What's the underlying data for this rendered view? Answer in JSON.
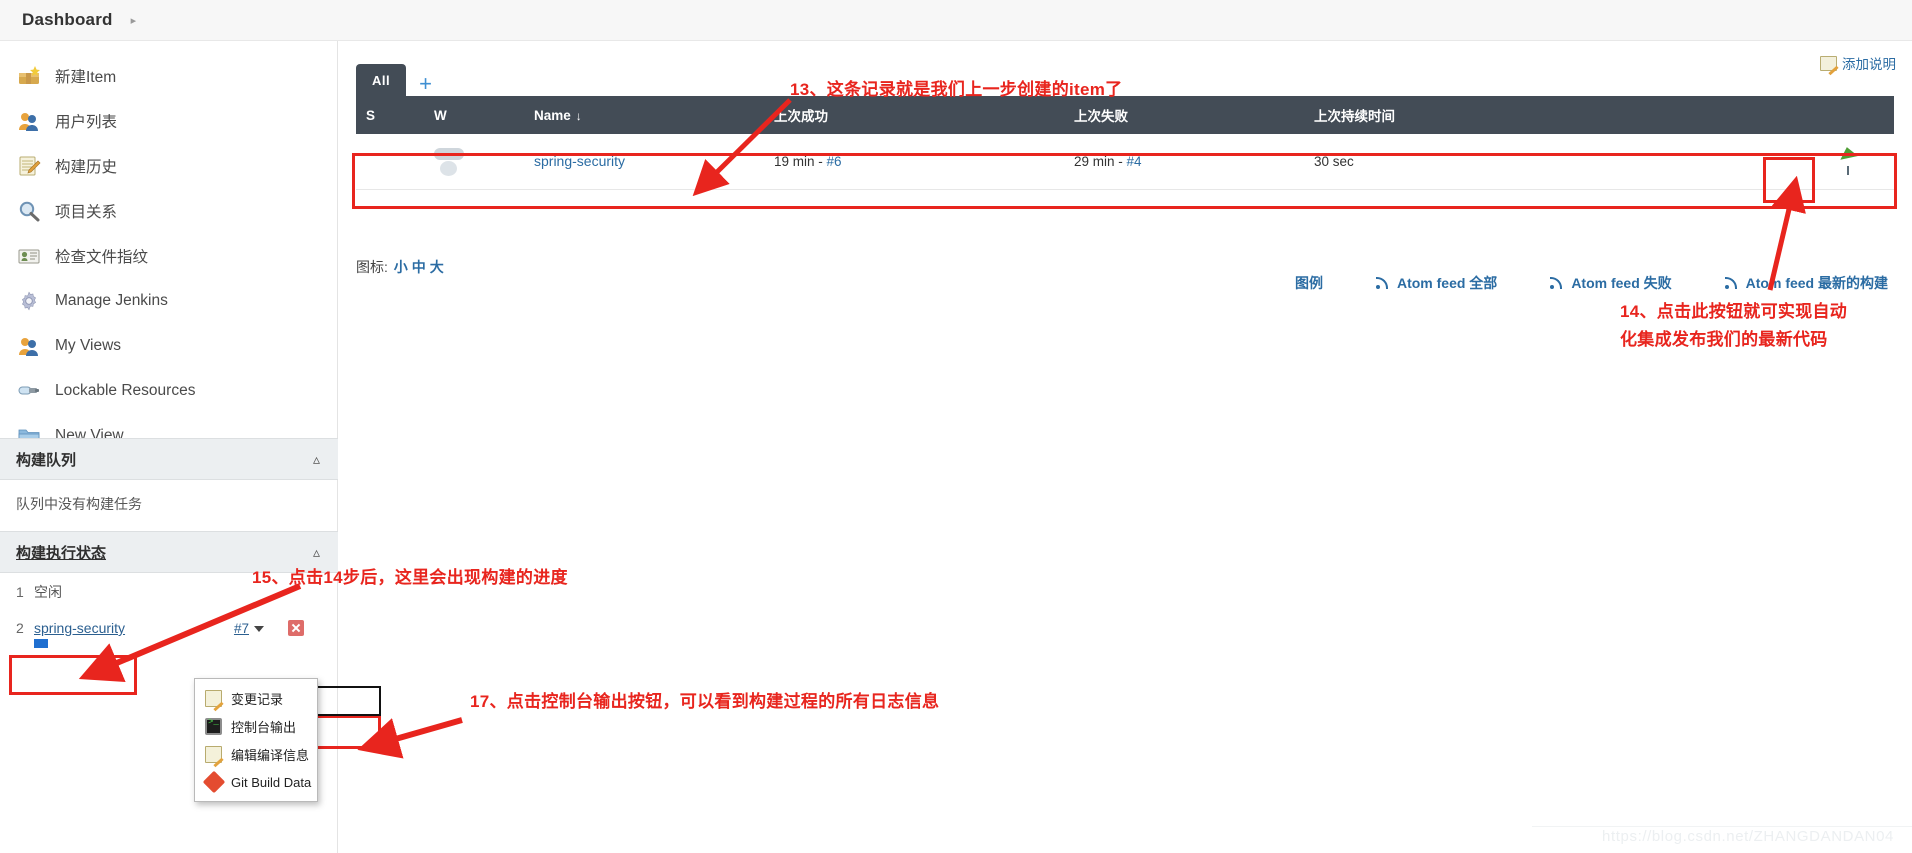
{
  "topbar": {
    "breadcrumb": "Dashboard",
    "crumb_arrow": "▸"
  },
  "sidebar": {
    "items": [
      {
        "label": "新建Item",
        "icon": "new-item-icon"
      },
      {
        "label": "用户列表",
        "icon": "users-icon"
      },
      {
        "label": "构建历史",
        "icon": "build-history-icon"
      },
      {
        "label": "项目关系",
        "icon": "magnifier-icon"
      },
      {
        "label": "检查文件指纹",
        "icon": "fingerprint-icon"
      },
      {
        "label": "Manage Jenkins",
        "icon": "gear-icon"
      },
      {
        "label": "My Views",
        "icon": "users-icon"
      },
      {
        "label": "Lockable Resources",
        "icon": "lock-resource-icon"
      },
      {
        "label": "New View",
        "icon": "folder-icon"
      }
    ],
    "build_queue": {
      "title": "构建队列",
      "collapse_icon": "chevron-up-icon",
      "empty_text": "队列中没有构建任务"
    },
    "build_executor": {
      "title": "构建执行状态",
      "collapse_icon": "chevron-up-icon",
      "rows": [
        {
          "num": "1",
          "label": "空闲",
          "is_link": false,
          "build": "",
          "running": false
        },
        {
          "num": "2",
          "label": "spring-security",
          "is_link": true,
          "build": "#7",
          "running": true
        }
      ]
    }
  },
  "main": {
    "add_description": "添加说明",
    "tabs": [
      {
        "label": "All",
        "active": true
      }
    ],
    "add_tab": "+",
    "table": {
      "headers": [
        "S",
        "W",
        "Name",
        "上次成功",
        "上次失败",
        "上次持续时间",
        ""
      ],
      "name_sort_arrow": "↓",
      "rows": [
        {
          "status_icon": "status-ball-icon",
          "weather_icon": "weather-cloudy-icon",
          "name": "spring-security",
          "last_success": "19 min - ",
          "last_success_build": "#6",
          "last_failure": "29 min - ",
          "last_failure_build": "#4",
          "last_duration": "30 sec",
          "build_button_icon": "schedule-build-icon"
        }
      ]
    },
    "legend": {
      "prefix": "图标:",
      "sizes": [
        "小",
        "中",
        "大"
      ]
    },
    "footer_links": [
      {
        "label": "图例",
        "icon": ""
      },
      {
        "label": "Atom feed 全部",
        "icon": "rss-icon"
      },
      {
        "label": "Atom feed 失败",
        "icon": "rss-icon"
      },
      {
        "label": "Atom feed 最新的构建",
        "icon": "rss-icon"
      }
    ]
  },
  "context_menu": {
    "items": [
      {
        "label": "变更记录",
        "icon": "changes-note-icon"
      },
      {
        "label": "控制台输出",
        "icon": "console-output-icon"
      },
      {
        "label": "编辑编译信息",
        "icon": "edit-build-info-icon"
      },
      {
        "label": "Git Build Data",
        "icon": "git-diamond-icon"
      }
    ]
  },
  "annotations": [
    {
      "id": "anno-13",
      "text": "13、这条记录就是我们上一步创建的item了"
    },
    {
      "id": "anno-14-line1",
      "text": "14、点击此按钮就可实现自动"
    },
    {
      "id": "anno-14-line2",
      "text": "化集成发布我们的最新代码"
    },
    {
      "id": "anno-15",
      "text": "15、点击14步后，这里会出现构建的进度"
    },
    {
      "id": "anno-17",
      "text": "17、点击控制台输出按钮，可以看到构建过程的所有日志信息"
    }
  ],
  "watermark": "https://blog.csdn.net/ZHANGDANDAN04",
  "colors": {
    "accent_red": "#e8251e",
    "table_header": "#434c56",
    "link_blue": "#2b6ca3",
    "panel_grey": "#eceff1"
  }
}
